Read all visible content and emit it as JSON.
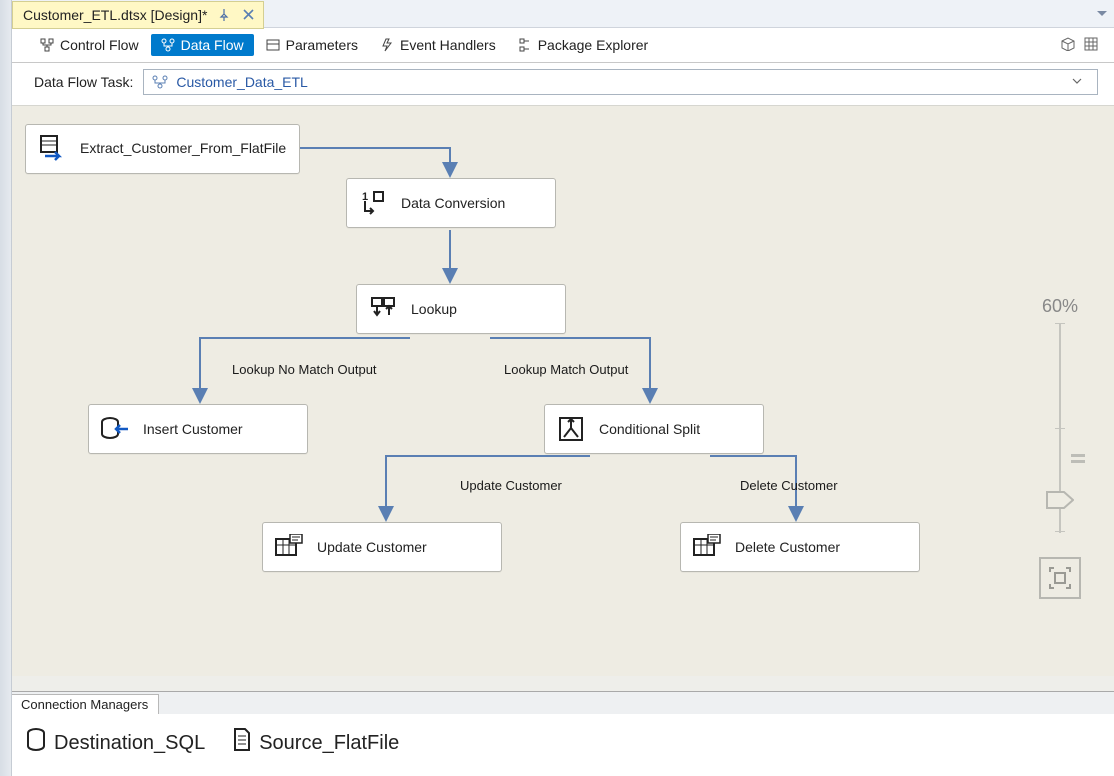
{
  "docTab": {
    "title": "Customer_ETL.dtsx [Design]*"
  },
  "viewTabs": {
    "controlFlow": "Control Flow",
    "dataFlow": "Data Flow",
    "parameters": "Parameters",
    "eventHandlers": "Event Handlers",
    "packageExplorer": "Package Explorer"
  },
  "dataFlowTask": {
    "label": "Data Flow Task:",
    "selected": "Customer_Data_ETL"
  },
  "nodes": {
    "extract": "Extract_Customer_From_FlatFile",
    "dataConversion": "Data Conversion",
    "lookup": "Lookup",
    "insertCustomer": "Insert Customer",
    "conditionalSplit": "Conditional Split",
    "updateCustomer": "Update Customer",
    "deleteCustomer": "Delete Customer"
  },
  "edgeLabels": {
    "lookupNoMatch": "Lookup No Match Output",
    "lookupMatch": "Lookup Match Output",
    "updateCustomer": "Update Customer",
    "deleteCustomer": "Delete Customer"
  },
  "zoom": {
    "percent": "60%"
  },
  "connectionManagers": {
    "tab": "Connection Managers",
    "items": {
      "destination": "Destination_SQL",
      "source": "Source_FlatFile"
    }
  }
}
